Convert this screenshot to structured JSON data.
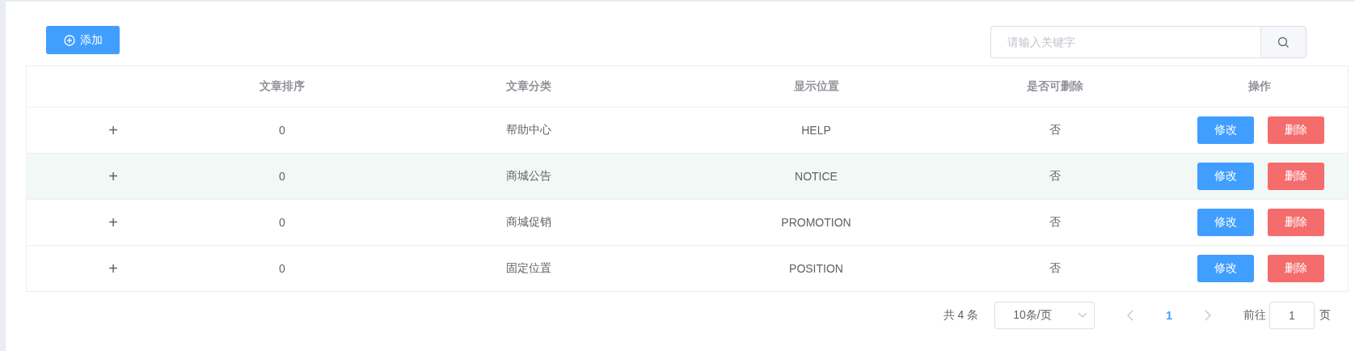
{
  "toolbar": {
    "add_button": "添加",
    "search": {
      "placeholder": "请输入关键字"
    }
  },
  "table": {
    "columns": [
      "",
      "文章排序",
      "文章分类",
      "显示位置",
      "是否可删除",
      "操作"
    ],
    "rows": [
      {
        "expand": "+",
        "order": "0",
        "category": "帮助中心",
        "position": "HELP",
        "deletable": "否",
        "actions": [
          "修改",
          "删除"
        ],
        "hovered": false
      },
      {
        "expand": "+",
        "order": "0",
        "category": "商城公告",
        "position": "NOTICE",
        "deletable": "否",
        "actions": [
          "修改",
          "删除"
        ],
        "hovered": true
      },
      {
        "expand": "+",
        "order": "0",
        "category": "商城促销",
        "position": "PROMOTION",
        "deletable": "否",
        "actions": [
          "修改",
          "删除"
        ],
        "hovered": false
      },
      {
        "expand": "+",
        "order": "0",
        "category": "固定位置",
        "position": "POSITION",
        "deletable": "否",
        "actions": [
          "修改",
          "删除"
        ],
        "hovered": false
      }
    ]
  },
  "pagination": {
    "total": "共 4 条",
    "page_size": "10条/页",
    "pages": [
      {
        "label": "1",
        "selected": true
      }
    ],
    "goto_label": "前往",
    "goto_value": "1",
    "page_unit": "页"
  }
}
